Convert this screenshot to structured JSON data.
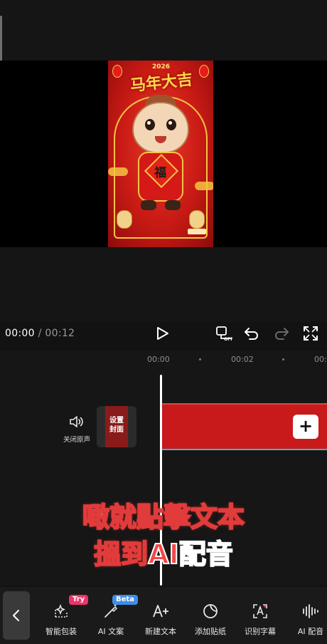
{
  "preview": {
    "art_year": "2026",
    "art_title": "马年大吉",
    "art_fu": "福"
  },
  "playback": {
    "current_time": "00:00",
    "separator": "/",
    "total_time": "00:12"
  },
  "ruler": {
    "ticks": [
      "00:00",
      "00:02",
      "00:0"
    ]
  },
  "track": {
    "mute_label": "关闭原声",
    "cover_label_line1": "设置",
    "cover_label_line2": "封面",
    "add_symbol": "+"
  },
  "overlay": {
    "line1": "噉就點擊文本",
    "line2_prefix": "搵到",
    "line2_highlight": "AI配音"
  },
  "toolbar": {
    "items": [
      {
        "label": "智能包装",
        "badge": "Try"
      },
      {
        "label": "AI 文案",
        "badge": "Beta"
      },
      {
        "label": "新建文本"
      },
      {
        "label": "添加贴纸"
      },
      {
        "label": "识别字幕"
      },
      {
        "label": "AI 配音"
      }
    ]
  },
  "colors": {
    "clip": "#c8191b",
    "playhead": "#ffffff",
    "try_badge": "#e8356a",
    "beta_badge": "#3d8ee8",
    "overlay_stroke": "#e23b3b"
  }
}
